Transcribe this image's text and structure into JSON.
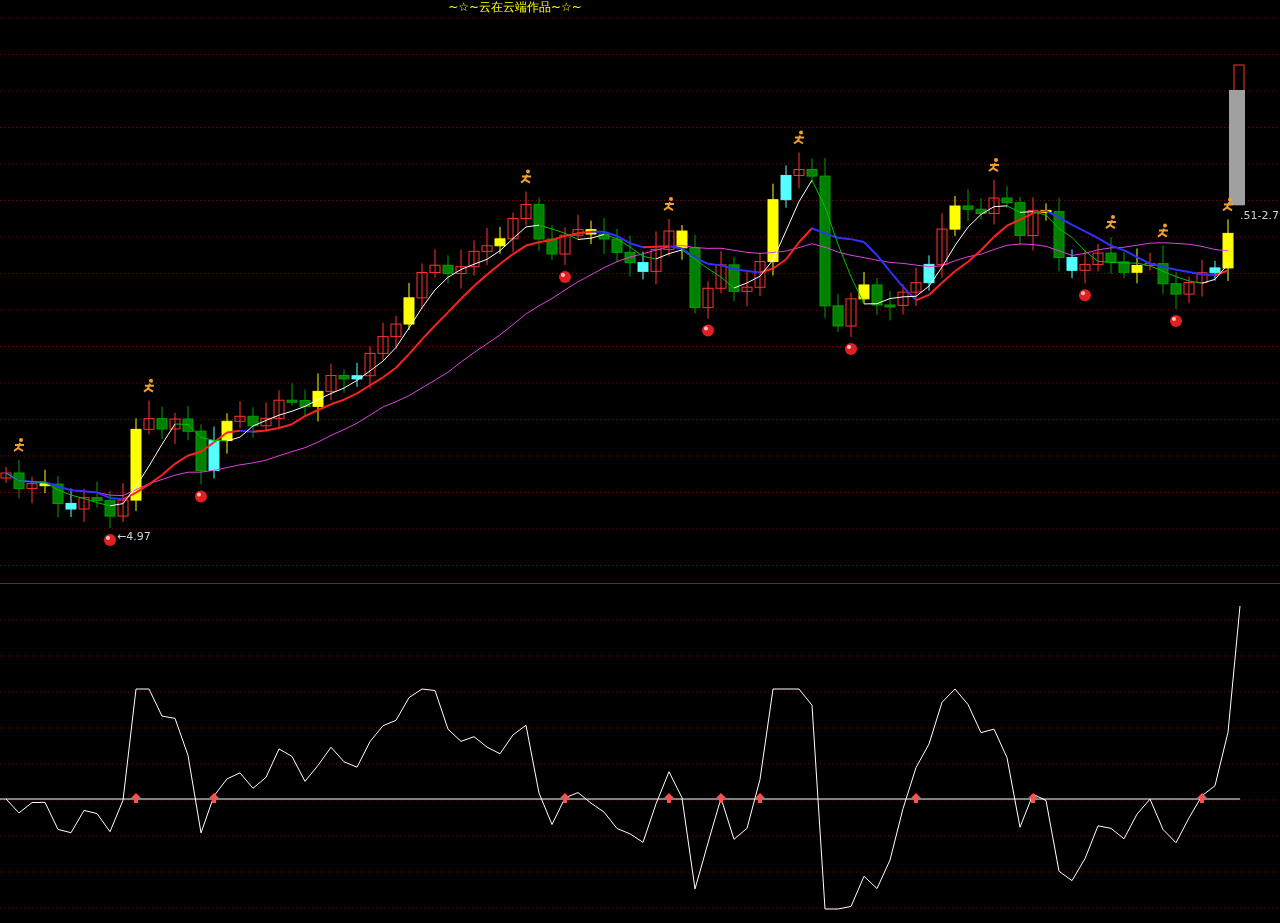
{
  "title": "~☆~云在云端作品~☆~",
  "price_chart": {
    "low_label": "←4.97",
    "high_label": ".51-2.7"
  }
}
